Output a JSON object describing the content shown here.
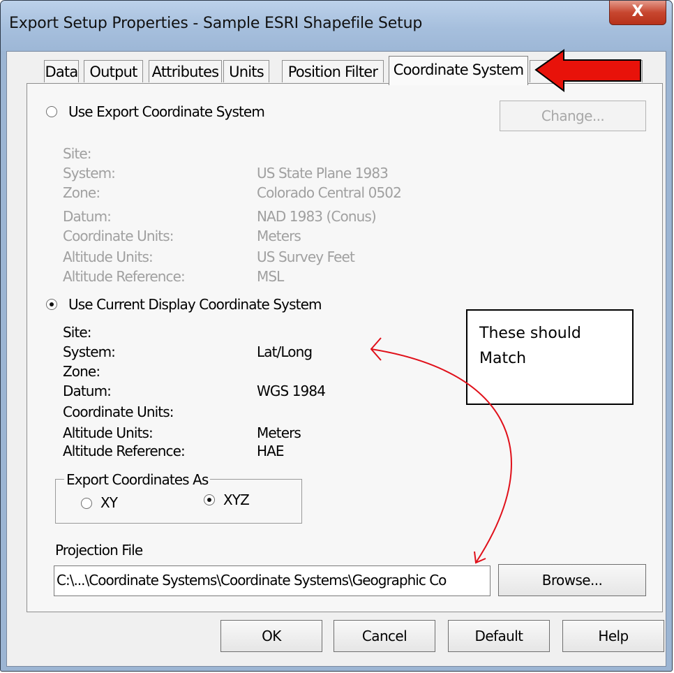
{
  "window": {
    "title": "Export Setup Properties - Sample ESRI Shapefile Setup",
    "close_label": "X"
  },
  "tabs": [
    {
      "label": "Data"
    },
    {
      "label": "Output"
    },
    {
      "label": "Attributes"
    },
    {
      "label": "Units"
    },
    {
      "label": "Position Filter"
    },
    {
      "label": "Coordinate System"
    }
  ],
  "export_cs": {
    "radio_label": "Use Export Coordinate System",
    "selected": false,
    "change_button": "Change...",
    "fields": [
      {
        "label": "Site:",
        "value": ""
      },
      {
        "label": "System:",
        "value": "US State Plane 1983"
      },
      {
        "label": "Zone:",
        "value": "Colorado Central 0502"
      },
      {
        "label": "Datum:",
        "value": "NAD 1983 (Conus)"
      },
      {
        "label": "Coordinate Units:",
        "value": "Meters"
      },
      {
        "label": "Altitude Units:",
        "value": "US Survey Feet"
      },
      {
        "label": "Altitude Reference:",
        "value": "MSL"
      }
    ]
  },
  "display_cs": {
    "radio_label": "Use Current Display Coordinate System",
    "selected": true,
    "fields": [
      {
        "label": "Site:",
        "value": ""
      },
      {
        "label": "System:",
        "value": "Lat/Long"
      },
      {
        "label": "Zone:",
        "value": ""
      },
      {
        "label": "Datum:",
        "value": "WGS 1984"
      },
      {
        "label": "Coordinate Units:",
        "value": ""
      },
      {
        "label": "Altitude Units:",
        "value": "Meters"
      },
      {
        "label": "Altitude Reference:",
        "value": "HAE"
      }
    ]
  },
  "export_coords": {
    "group_label": "Export Coordinates As",
    "options": [
      {
        "label": "XY",
        "selected": false
      },
      {
        "label": "XYZ",
        "selected": true
      }
    ]
  },
  "projection": {
    "label": "Projection File",
    "value": "C:\\...\\Coordinate Systems\\Coordinate Systems\\Geographic Co",
    "browse_button": "Browse..."
  },
  "footer": {
    "ok": "OK",
    "cancel": "Cancel",
    "default": "Default",
    "help": "Help"
  },
  "annotation": {
    "note_line1": "These should",
    "note_line2": "Match",
    "arrow_color": "#e8120a",
    "curve_color": "#e0101a"
  }
}
